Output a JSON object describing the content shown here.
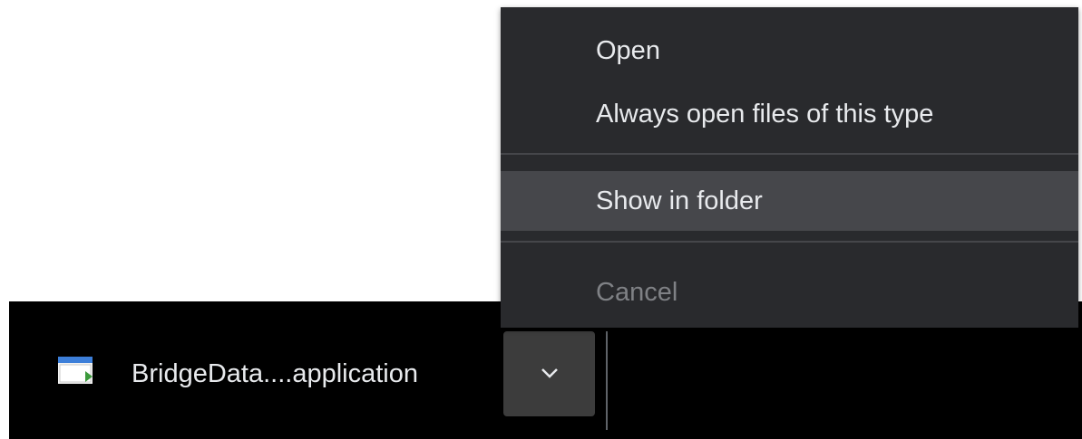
{
  "context_menu": {
    "items": [
      {
        "label": "Open",
        "enabled": true
      },
      {
        "label": "Always open files of this type",
        "enabled": true
      },
      {
        "label": "Show in folder",
        "enabled": true,
        "highlighted": true
      },
      {
        "label": "Cancel",
        "enabled": false
      }
    ]
  },
  "download_item": {
    "file_name": "BridgeData....application",
    "icon": "application-file-icon",
    "menu_icon": "chevron-down-icon"
  },
  "colors": {
    "shelf_background": "#000000",
    "menu_background": "#292a2d",
    "menu_highlight": "#46474b",
    "text": "#e8eaed",
    "disabled_text": "#7f8185"
  }
}
